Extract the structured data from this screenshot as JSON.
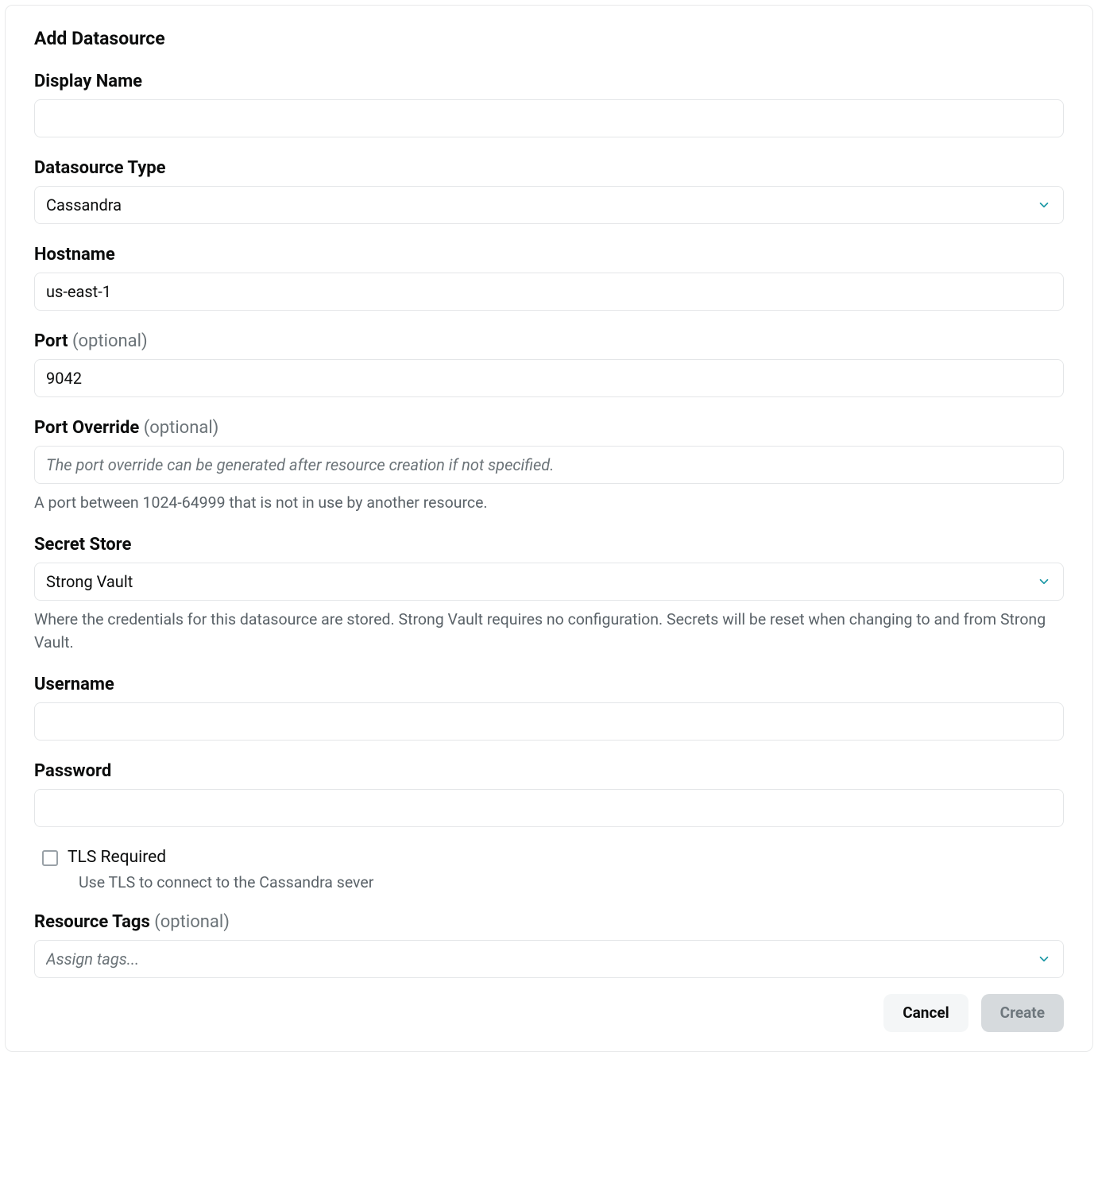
{
  "panel": {
    "title": "Add Datasource"
  },
  "fields": {
    "displayName": {
      "label": "Display Name",
      "value": ""
    },
    "datasourceType": {
      "label": "Datasource Type",
      "value": "Cassandra"
    },
    "hostname": {
      "label": "Hostname",
      "value": "us-east-1"
    },
    "port": {
      "label": "Port ",
      "optional": "(optional)",
      "value": "9042"
    },
    "portOverride": {
      "label": "Port Override ",
      "optional": "(optional)",
      "placeholder": "The port override can be generated after resource creation if not specified.",
      "value": "",
      "help": "A port between 1024-64999 that is not in use by another resource."
    },
    "secretStore": {
      "label": "Secret Store",
      "value": "Strong Vault",
      "help": "Where the credentials for this datasource are stored. Strong Vault requires no configuration. Secrets will be reset when changing to and from Strong Vault."
    },
    "username": {
      "label": "Username",
      "value": ""
    },
    "password": {
      "label": "Password",
      "value": ""
    },
    "tlsRequired": {
      "label": "TLS Required",
      "help": "Use TLS to connect to the Cassandra sever",
      "checked": false
    },
    "resourceTags": {
      "label": "Resource Tags ",
      "optional": "(optional)",
      "placeholder": "Assign tags...",
      "value": ""
    }
  },
  "footer": {
    "cancel": "Cancel",
    "create": "Create"
  }
}
